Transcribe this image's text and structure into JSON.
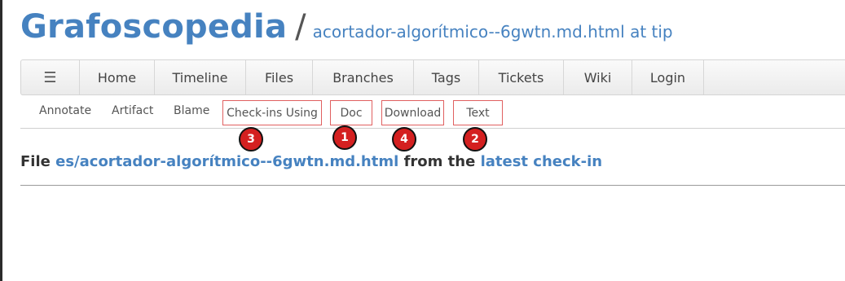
{
  "header": {
    "app_title": "Grafoscopedia",
    "separator": "/",
    "page_subtitle": "acortador-algorítmico--6gwtn.md.html at tip"
  },
  "mainmenu": {
    "hamburger_glyph": "☰",
    "items": [
      "Home",
      "Timeline",
      "Files",
      "Branches",
      "Tags",
      "Tickets",
      "Wiki",
      "Login"
    ]
  },
  "submenu": {
    "items": [
      "Annotate",
      "Artifact",
      "Blame",
      "Check-ins Using",
      "Doc",
      "Download",
      "Text"
    ]
  },
  "annotations": {
    "badges": [
      "3",
      "1",
      "4",
      "2"
    ],
    "badge_color": "#d42020",
    "box_color": "#e06060"
  },
  "file_info": {
    "prefix": "File",
    "path": "es/acortador-algorítmico--6gwtn.md.html",
    "middle": "from the",
    "checkin_link": "latest check-in"
  },
  "colors": {
    "link": "#4682c0",
    "text": "#333333"
  }
}
